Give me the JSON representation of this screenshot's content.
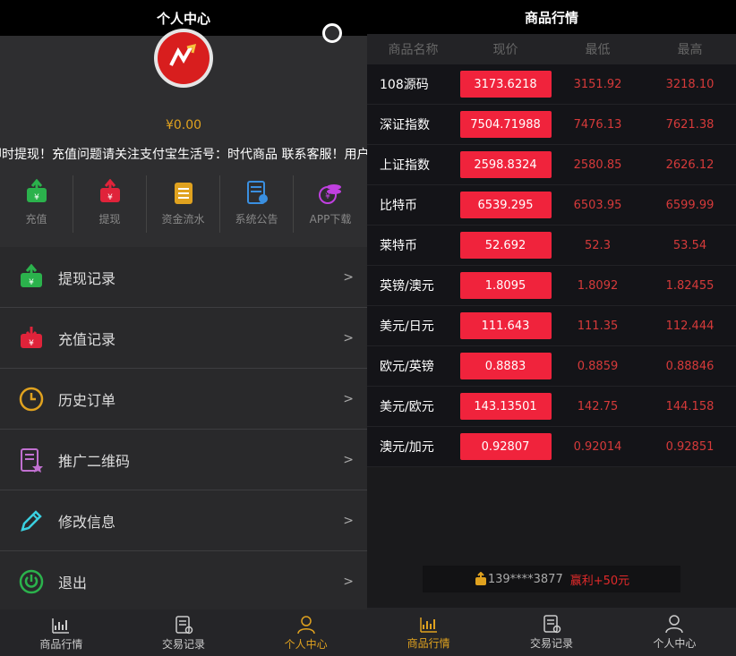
{
  "left": {
    "header_title": "个人中心",
    "balance": "¥0.00",
    "notice": "即时提现！充值问题请关注支付宝生活号：时代商品 联系客服！用户",
    "quick_actions": [
      {
        "label": "充值",
        "icon": "recharge-icon",
        "color": "#2bb24c"
      },
      {
        "label": "提现",
        "icon": "withdraw-icon",
        "color": "#e0233a"
      },
      {
        "label": "资金流水",
        "icon": "ledger-icon",
        "color": "#e0a21f"
      },
      {
        "label": "系统公告",
        "icon": "announcement-icon",
        "color": "#3a8fe0"
      },
      {
        "label": "APP下载",
        "icon": "app-download-icon",
        "color": "#c040e0"
      }
    ],
    "menu": [
      {
        "label": "提现记录",
        "icon": "withdraw-record-icon",
        "arrow": ">"
      },
      {
        "label": "充值记录",
        "icon": "recharge-record-icon",
        "arrow": ">"
      },
      {
        "label": "历史订单",
        "icon": "clock-icon",
        "arrow": ">"
      },
      {
        "label": "推广二维码",
        "icon": "qrcode-doc-icon",
        "arrow": ">"
      },
      {
        "label": "修改信息",
        "icon": "pencil-icon",
        "arrow": ">"
      },
      {
        "label": "退出",
        "icon": "power-icon",
        "arrow": ">"
      }
    ],
    "tabs": [
      {
        "label": "商品行情",
        "icon": "chart-icon"
      },
      {
        "label": "交易记录",
        "icon": "record-icon"
      },
      {
        "label": "个人中心",
        "icon": "user-icon"
      }
    ]
  },
  "right": {
    "header_title": "商品行情",
    "columns": [
      "商品名称",
      "现价",
      "最低",
      "最高"
    ],
    "rows": [
      {
        "name": "108源码",
        "price": "3173.6218",
        "low": "3151.92",
        "high": "3218.10"
      },
      {
        "name": "深证指数",
        "price": "7504.71988",
        "low": "7476.13",
        "high": "7621.38"
      },
      {
        "name": "上证指数",
        "price": "2598.8324",
        "low": "2580.85",
        "high": "2626.12"
      },
      {
        "name": "比特币",
        "price": "6539.295",
        "low": "6503.95",
        "high": "6599.99"
      },
      {
        "name": "莱特币",
        "price": "52.692",
        "low": "52.3",
        "high": "53.54"
      },
      {
        "name": "英镑/澳元",
        "price": "1.8095",
        "low": "1.8092",
        "high": "1.82455"
      },
      {
        "name": "美元/日元",
        "price": "111.643",
        "low": "111.35",
        "high": "112.444"
      },
      {
        "name": "欧元/英镑",
        "price": "0.8883",
        "low": "0.8859",
        "high": "0.88846"
      },
      {
        "name": "美元/欧元",
        "price": "143.13501",
        "low": "142.75",
        "high": "144.158"
      },
      {
        "name": "澳元/加元",
        "price": "0.92807",
        "low": "0.92014",
        "high": "0.92851"
      }
    ],
    "ticker": {
      "user": "139****3877",
      "profit": "赢利+50元"
    },
    "tabs": [
      {
        "label": "商品行情",
        "icon": "chart-icon"
      },
      {
        "label": "交易记录",
        "icon": "record-icon"
      },
      {
        "label": "个人中心",
        "icon": "user-icon"
      }
    ]
  },
  "colors": {
    "accent": "#e0a21f",
    "price_bg": "#f0233c",
    "low_high": "#d63a3a"
  }
}
